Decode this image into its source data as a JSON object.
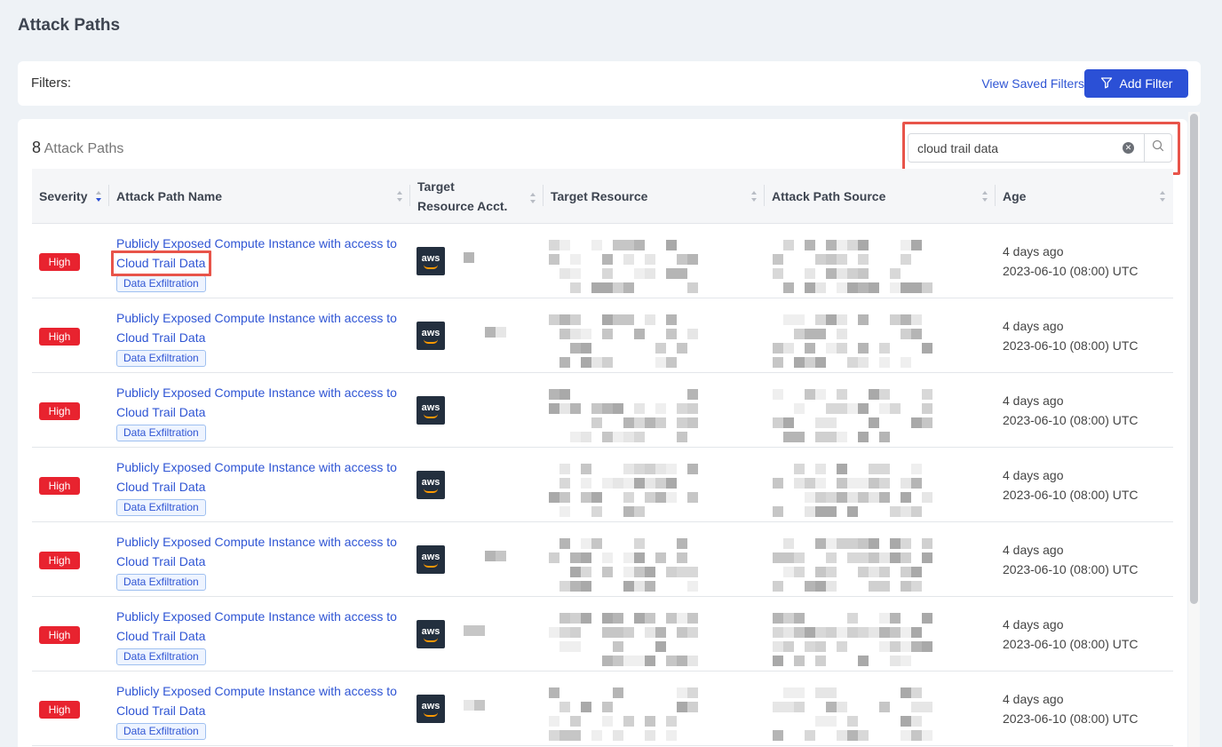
{
  "page": {
    "title": "Attack Paths"
  },
  "filters": {
    "label": "Filters:",
    "saved_link": "View Saved Filters",
    "add_button": "Add Filter"
  },
  "results": {
    "count": "8",
    "count_label": "Attack Paths"
  },
  "search": {
    "value": "cloud trail data"
  },
  "table": {
    "columns": [
      {
        "label": "Severity",
        "sorted": "desc"
      },
      {
        "label": "Attack Path Name"
      },
      {
        "label": "Target Resource Acct."
      },
      {
        "label": "Target Resource"
      },
      {
        "label": "Attack Path Source"
      },
      {
        "label": "Age"
      }
    ],
    "rows": [
      {
        "severity": "High",
        "name_prefix": "Publicly Exposed Compute Instance with access to ",
        "name_highlight": "Cloud Trail Data",
        "tag": "Data Exfiltration",
        "provider": "aws",
        "age": "4 days ago",
        "date": "2023-06-10 (08:00) UTC"
      },
      {
        "severity": "High",
        "name_prefix": "Publicly Exposed Compute Instance with access to ",
        "name_highlight": "Cloud Trail Data",
        "tag": "Data Exfiltration",
        "provider": "aws",
        "age": "4 days ago",
        "date": "2023-06-10 (08:00) UTC"
      },
      {
        "severity": "High",
        "name_prefix": "Publicly Exposed Compute Instance with access to ",
        "name_highlight": "Cloud Trail Data",
        "tag": "Data Exfiltration",
        "provider": "aws",
        "age": "4 days ago",
        "date": "2023-06-10 (08:00) UTC"
      },
      {
        "severity": "High",
        "name_prefix": "Publicly Exposed Compute Instance with access to ",
        "name_highlight": "Cloud Trail Data",
        "tag": "Data Exfiltration",
        "provider": "aws",
        "age": "4 days ago",
        "date": "2023-06-10 (08:00) UTC"
      },
      {
        "severity": "High",
        "name_prefix": "Publicly Exposed Compute Instance with access to ",
        "name_highlight": "Cloud Trail Data",
        "tag": "Data Exfiltration",
        "provider": "aws",
        "age": "4 days ago",
        "date": "2023-06-10 (08:00) UTC"
      },
      {
        "severity": "High",
        "name_prefix": "Publicly Exposed Compute Instance with access to ",
        "name_highlight": "Cloud Trail Data",
        "tag": "Data Exfiltration",
        "provider": "aws",
        "age": "4 days ago",
        "date": "2023-06-10 (08:00) UTC"
      },
      {
        "severity": "High",
        "name_prefix": "Publicly Exposed Compute Instance with access to ",
        "name_highlight": "Cloud Trail Data",
        "tag": "Data Exfiltration",
        "provider": "aws",
        "age": "4 days ago",
        "date": "2023-06-10 (08:00) UTC"
      }
    ]
  },
  "colors": {
    "accent": "#2b50d6",
    "severity_high": "#e8232f",
    "highlight_outline": "#e8544a"
  },
  "icons": {
    "filter": "filter-icon",
    "search": "search-icon",
    "clear": "clear-icon",
    "sort": "sort-icon"
  }
}
